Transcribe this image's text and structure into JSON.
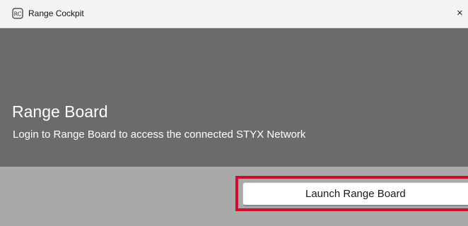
{
  "window": {
    "title": "Range Cockpit",
    "icon": "range-cockpit-app-icon",
    "close_glyph": "×"
  },
  "hero": {
    "title": "Range Board",
    "subtitle": "Login to Range Board to access the connected STYX Network"
  },
  "footer": {
    "launch_label": "Launch Range Board"
  },
  "colors": {
    "titlebar_bg": "#f3f3f3",
    "hero_bg": "#6b6b6b",
    "footer_bg": "#a9a9a9",
    "highlight": "#c8102e",
    "button_bg": "#ffffff"
  }
}
